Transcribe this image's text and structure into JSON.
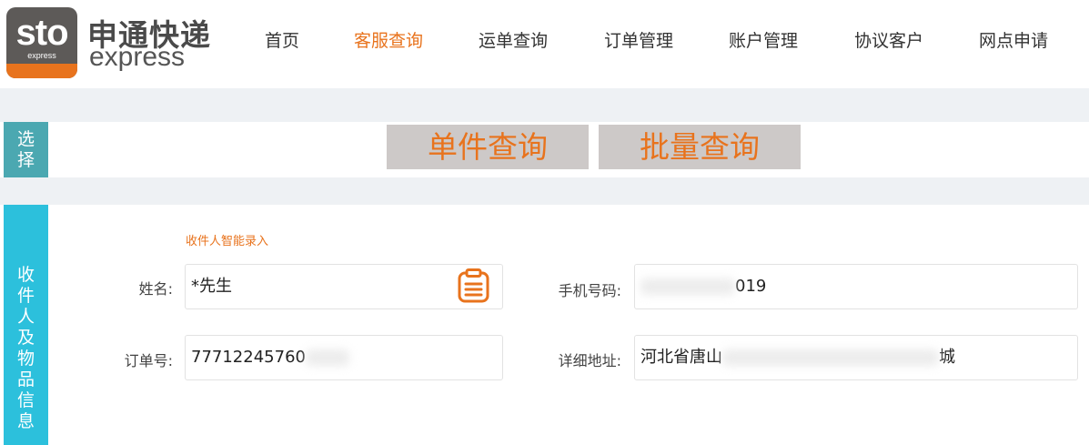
{
  "logo": {
    "mark_text": "sto",
    "mark_subtext": "express",
    "name_cn": "申通快递",
    "name_en": "express",
    "brand_color": "#e8731d"
  },
  "nav": {
    "items": [
      {
        "label": "首页",
        "active": false
      },
      {
        "label": "客服查询",
        "active": true
      },
      {
        "label": "运单查询",
        "active": false
      },
      {
        "label": "订单管理",
        "active": false
      },
      {
        "label": "账户管理",
        "active": false
      },
      {
        "label": "协议客户",
        "active": false
      },
      {
        "label": "网点申请",
        "active": false
      }
    ]
  },
  "select_section": {
    "side_label": [
      "选",
      "择"
    ],
    "tabs": [
      "单件查询",
      "批量查询"
    ]
  },
  "form_section": {
    "side_label": [
      "收",
      "件",
      "人",
      "及",
      "物",
      "品",
      "信",
      "息"
    ],
    "smart_entry_link": "收件人智能录入",
    "name_label": "姓名:",
    "name_value": "*先生",
    "phone_label": "手机号码:",
    "phone_value_visible": "019",
    "order_label": "订单号:",
    "order_value_visible": "77712245760",
    "address_label": "详细地址:",
    "address_value_start": "河北省唐山",
    "address_value_end": "城",
    "clipboard_icon": "clipboard-icon"
  },
  "colors": {
    "accent_orange": "#e8731d",
    "select_label_bg": "#4ba8b1",
    "form_label_bg": "#2cc0dc",
    "tab_bg": "#cdc9c8",
    "band_bg": "#eef1f4"
  }
}
